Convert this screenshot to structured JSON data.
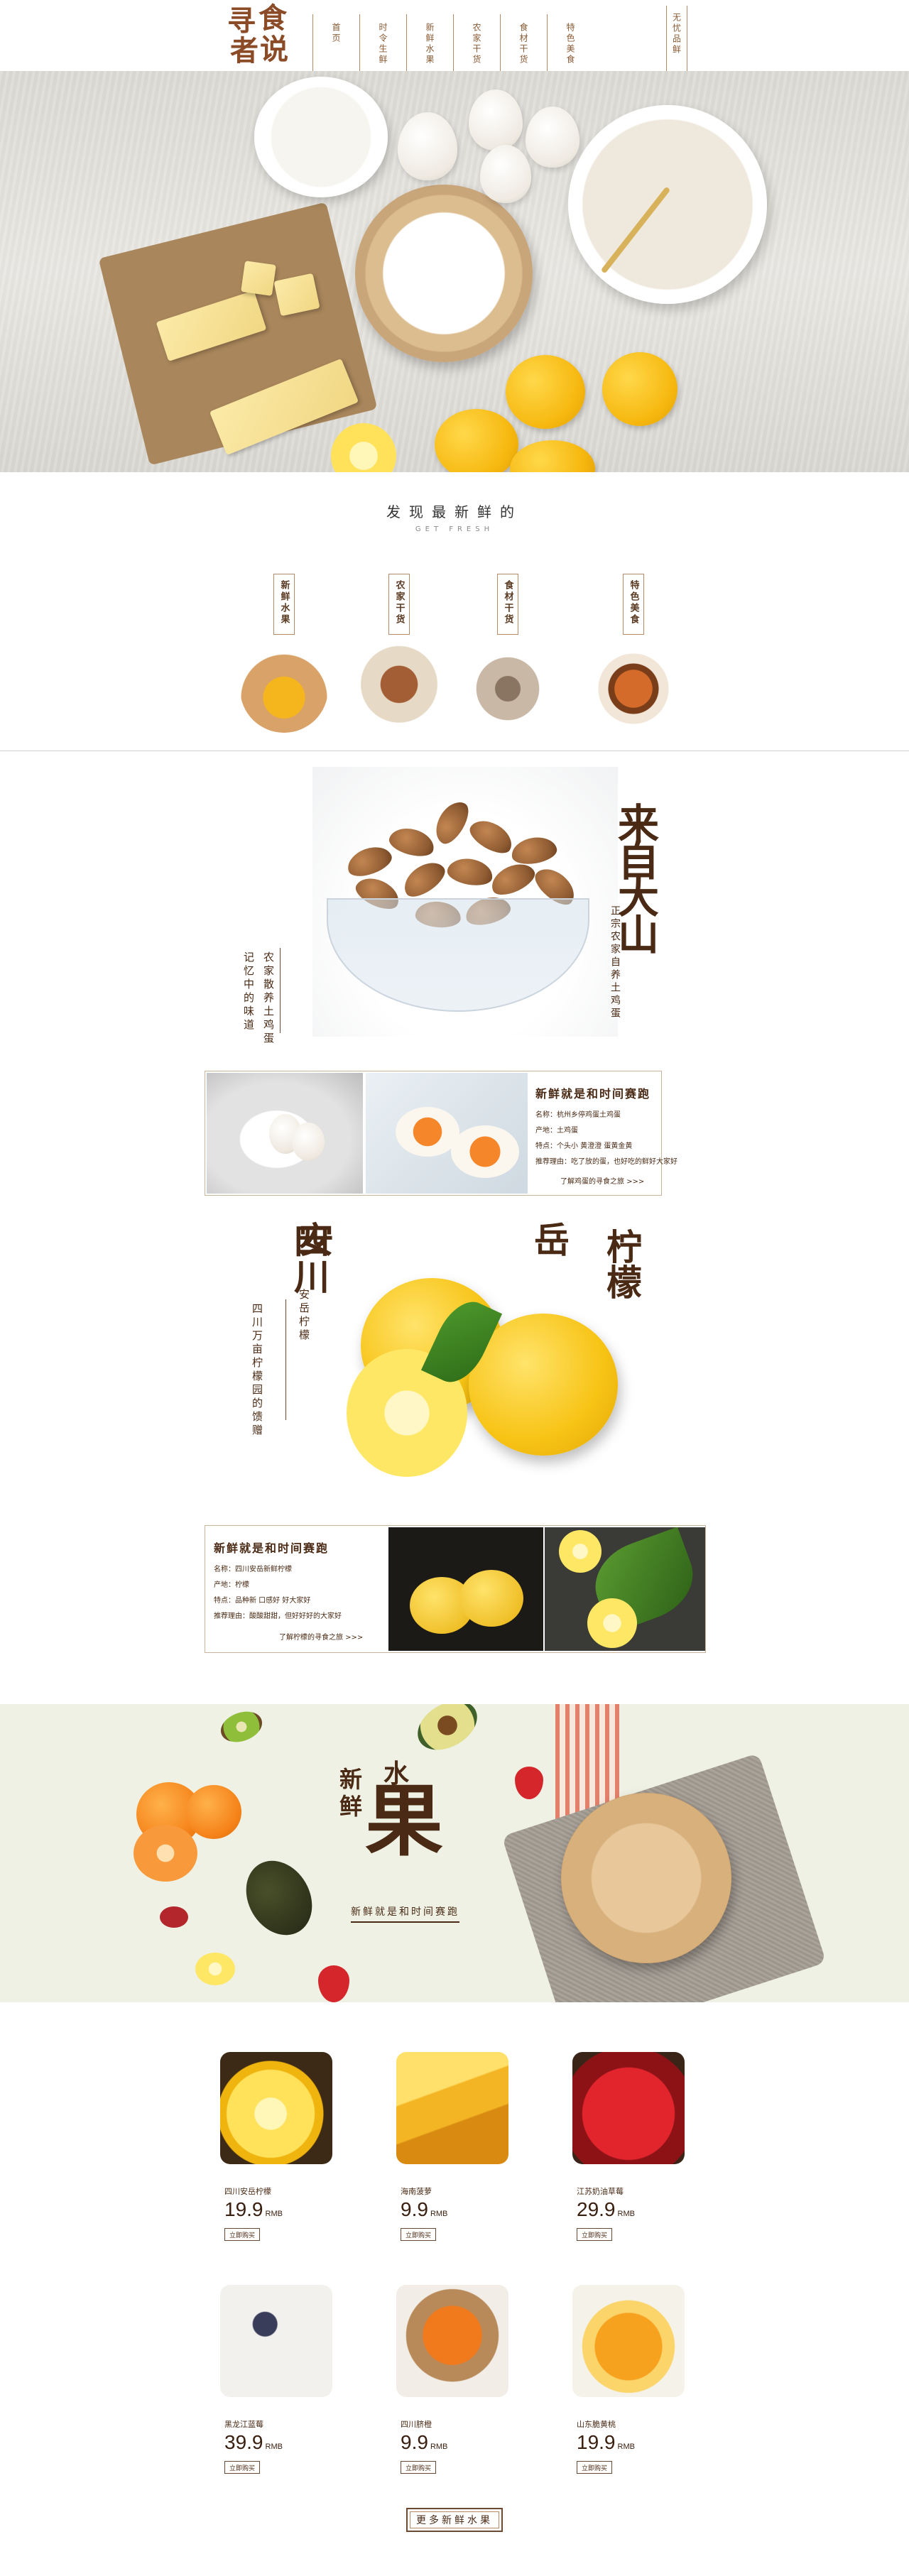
{
  "header": {
    "logo_chars": [
      "寻",
      "食",
      "者",
      "说"
    ],
    "nav": [
      "首页",
      "时令生鲜",
      "新鲜水果",
      "农家干货",
      "食材干货",
      "特色美食"
    ],
    "nav_right": "无忧品鲜"
  },
  "fresh": {
    "title": "发现最新鲜的",
    "subtitle": "GET FRESH",
    "categories": [
      "新鲜水果",
      "农家干货",
      "食材干货",
      "特色美食"
    ]
  },
  "almond_section": {
    "headline": "来自大山",
    "sub_right": "正宗农家自养土鸡蛋",
    "sub_left_1": "农家散养土鸡蛋",
    "sub_left_2": "记忆中的味道"
  },
  "egg_card": {
    "title": "新鲜就是和时间赛跑",
    "lines": [
      "名称：杭州乡停鸡蛋土鸡蛋",
      "产地：土鸡蛋",
      "特点：个头小 黄澄澄 蛋黄金黄",
      "推荐理由：吃了放的蛋，也好吃的鲜好大家好"
    ],
    "more": "了解鸡蛋的寻食之旅 >>>"
  },
  "lemon_section": {
    "big_1": "四川",
    "big_2": "安",
    "big_3": "岳",
    "big_4": "柠檬",
    "sub_1": "安岳柠檬",
    "sub_2": "四川万亩柠檬园的馈赠"
  },
  "lemon_card": {
    "title": "新鲜就是和时间赛跑",
    "lines": [
      "名称：四川安岳新鲜柠檬",
      "产地：柠檬",
      "特点：品种新 口感好 好大家好",
      "推荐理由：酸酸甜甜，但好好好的大家好"
    ],
    "more": "了解柠檬的寻食之旅 >>>"
  },
  "banner": {
    "small_1": "新",
    "small_2": "鲜",
    "small_3": "水",
    "big": "果",
    "tagline": "新鲜就是和时间赛跑"
  },
  "products": [
    {
      "name": "四川安岳柠檬",
      "price": "19.9",
      "unit": "RMB",
      "button": "立即购买"
    },
    {
      "name": "海南菠萝",
      "price": "9.9",
      "unit": "RMB",
      "button": "立即购买"
    },
    {
      "name": "江苏奶油草莓",
      "price": "29.9",
      "unit": "RMB",
      "button": "立即购买"
    },
    {
      "name": "黑龙江蓝莓",
      "price": "39.9",
      "unit": "RMB",
      "button": "立即购买"
    },
    {
      "name": "四川脐橙",
      "price": "9.9",
      "unit": "RMB",
      "button": "立即购买"
    },
    {
      "name": "山东脆黄桃",
      "price": "19.9",
      "unit": "RMB",
      "button": "立即购买"
    }
  ],
  "more_button": "更多新鲜水果",
  "colors": {
    "brand_brown": "#4a2a14",
    "accent": "#8a4b26",
    "lemon": "#f6b80f",
    "banner_bg": "#eef1e4"
  }
}
